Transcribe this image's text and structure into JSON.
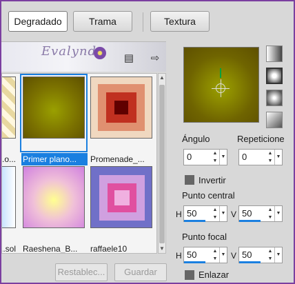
{
  "tabs": [
    "Degradado",
    "Trama",
    "Textura"
  ],
  "logo": "Evalynda",
  "gallery": {
    "items": [
      {
        "caption": "...o..."
      },
      {
        "caption": "Primer plano..."
      },
      {
        "caption": "Promenade_..."
      },
      {
        "caption": "...sol"
      },
      {
        "caption": "Raeshena_B..."
      },
      {
        "caption": "raffaele10"
      }
    ]
  },
  "buttons": {
    "reset": "Restablec...",
    "save": "Guardar"
  },
  "angle": {
    "label": "Ángulo",
    "value": "0"
  },
  "repeat": {
    "label": "Repeticione",
    "value": "0"
  },
  "invert_label": "Invertir",
  "center_point": {
    "label": "Punto central",
    "h_label": "H",
    "h": "50",
    "v_label": "V",
    "v": "50"
  },
  "focal_point": {
    "label": "Punto focal",
    "h_label": "H",
    "h": "50",
    "v_label": "V",
    "v": "50"
  },
  "link_label": "Enlazar",
  "colors": {
    "accent": "#1a7fe0",
    "window_border": "#7b3fa0",
    "gradient_fg": "#8a8800"
  }
}
